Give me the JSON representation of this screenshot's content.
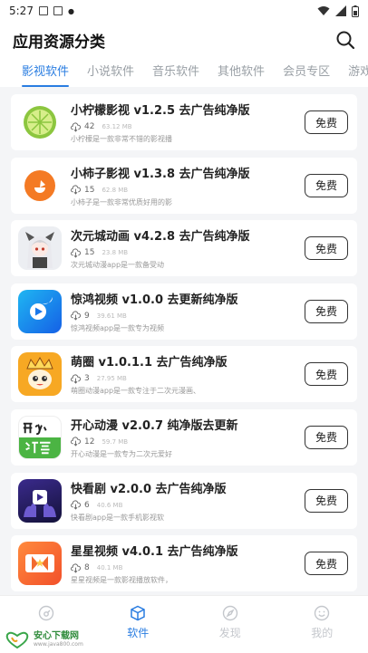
{
  "status_bar": {
    "time": "5:27"
  },
  "header": {
    "title": "应用资源分类"
  },
  "tabs": [
    {
      "label": "影视软件",
      "active": true
    },
    {
      "label": "小说软件",
      "active": false
    },
    {
      "label": "音乐软件",
      "active": false
    },
    {
      "label": "其他软件",
      "active": false
    },
    {
      "label": "会员专区",
      "active": false
    },
    {
      "label": "游戏",
      "active": false
    }
  ],
  "apps": [
    {
      "name": "小柠檬影视 v1.2.5 去广告纯净版",
      "downloads": "42",
      "size": "63.12 MB",
      "desc": "小柠檬是一款非常不错的影视播",
      "button": "免费",
      "icon": "lemon-icon"
    },
    {
      "name": "小柿子影视 v1.3.8 去广告纯净版",
      "downloads": "15",
      "size": "62.8 MB",
      "desc": "小柿子是一款非常优质好用的影",
      "button": "免费",
      "icon": "persimmon-icon"
    },
    {
      "name": "次元城动画 v4.2.8 去广告纯净版",
      "downloads": "15",
      "size": "23.8 MB",
      "desc": "次元城动漫app是一款备受动",
      "button": "免费",
      "icon": "anime-girl-icon"
    },
    {
      "name": "惊鸿视频 v1.0.0 去更新纯净版",
      "downloads": "9",
      "size": "39.61 MB",
      "desc": "惊鸿视频app是一款专为视频",
      "button": "免费",
      "icon": "jinghong-icon"
    },
    {
      "name": "萌圈 v1.0.1.1 去广告纯净版",
      "downloads": "3",
      "size": "27.95 MB",
      "desc": "萌圈动漫app是一款专注于二次元漫画、",
      "button": "免费",
      "icon": "mengquan-icon"
    },
    {
      "name": "开心动漫 v2.0.7 纯净版去更新",
      "downloads": "12",
      "size": "59.7 MB",
      "desc": "开心动漫是一款专为二次元爱好",
      "button": "免费",
      "icon": "kaixin-icon"
    },
    {
      "name": "快看剧 v2.0.0 去广告纯净版",
      "downloads": "6",
      "size": "40.6 MB",
      "desc": "快看剧app是一款手机影视软",
      "button": "免费",
      "icon": "kuaikanju-icon"
    },
    {
      "name": "星星视频 v4.0.1 去广告纯净版",
      "downloads": "8",
      "size": "40.1 MB",
      "desc": "星星视频是一款影视播放软件，",
      "button": "免费",
      "icon": "xingxing-icon"
    }
  ],
  "bottom_nav": [
    {
      "label": "",
      "icon": "home-icon",
      "active": false
    },
    {
      "label": "软件",
      "icon": "box-icon",
      "active": true
    },
    {
      "label": "发现",
      "icon": "compass-icon",
      "active": false
    },
    {
      "label": "我的",
      "icon": "smile-icon",
      "active": false
    }
  ],
  "watermark": {
    "brand": "安心下载网",
    "url": "www.java800.com"
  }
}
